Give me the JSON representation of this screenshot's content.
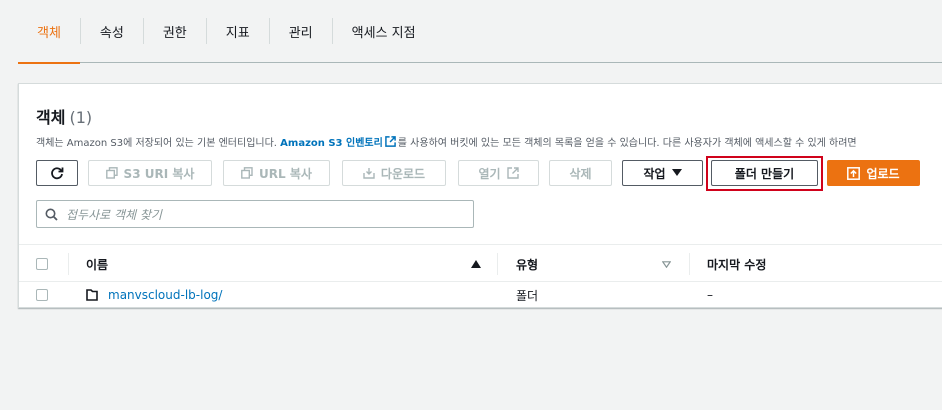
{
  "tabs": [
    {
      "label": "객체",
      "active": true
    },
    {
      "label": "속성",
      "active": false
    },
    {
      "label": "권한",
      "active": false
    },
    {
      "label": "지표",
      "active": false
    },
    {
      "label": "관리",
      "active": false
    },
    {
      "label": "액세스 지점",
      "active": false
    }
  ],
  "panel": {
    "title": "객체",
    "count": "(1)",
    "desc_before": "객체는 Amazon S3에 저장되어 있는 기본 엔터티입니다. ",
    "desc_link": "Amazon S3 인벤토리",
    "desc_after": "를 사용하여 버킷에 있는 모든 객체의 목록을 얻을 수 있습니다. 다른 사용자가 객체에 액세스할 수 있게 하려면"
  },
  "toolbar": {
    "copy_s3_uri": "S3 URI 복사",
    "copy_url": "URL 복사",
    "download": "다운로드",
    "open": "열기",
    "delete": "삭제",
    "actions": "작업",
    "create_folder": "폴더 만들기",
    "upload": "업로드"
  },
  "search": {
    "placeholder": "접두사로 객체 찾기"
  },
  "table": {
    "headers": {
      "name": "이름",
      "type": "유형",
      "modified": "마지막 수정"
    },
    "rows": [
      {
        "name": "manvscloud-lb-log/",
        "type": "폴더",
        "modified": "–"
      }
    ]
  },
  "colors": {
    "accent": "#ec7211",
    "link": "#0073bb",
    "highlight": "#d0021b"
  }
}
